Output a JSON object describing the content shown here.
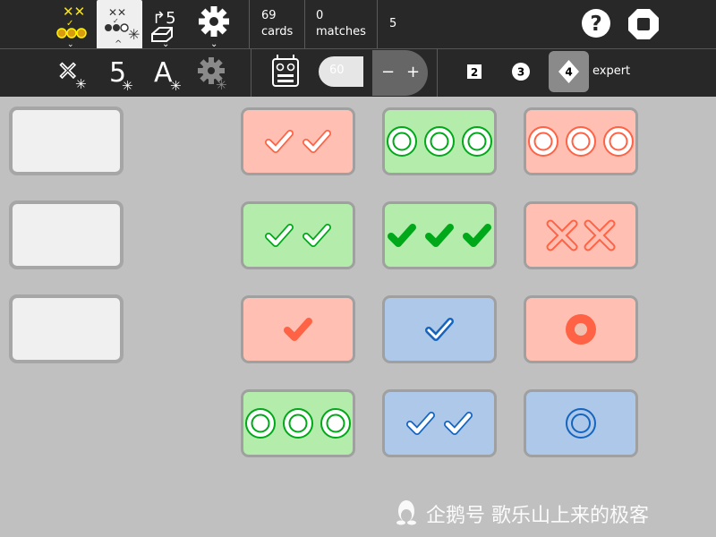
{
  "toolbar": {
    "stats": {
      "cards_count": "69",
      "cards_label": "cards",
      "matches_count": "0",
      "matches_label": "matches",
      "deck_remaining": "5"
    },
    "speed_value": "60",
    "stepper_minus": "−",
    "stepper_plus": "+",
    "levels": [
      "2",
      "3",
      "4"
    ],
    "active_level": "4",
    "level_name": "expert"
  },
  "watermark": "企鹅号 歌乐山上来的极客",
  "colors": {
    "red_card": "#ffc0b3",
    "red_shape": "#ff6244",
    "green_card": "#b3ecab",
    "green_shape": "#00a81a",
    "blue_card": "#adc8e8",
    "blue_shape": "#1565c0",
    "toolbar": "#282828"
  },
  "cards": [
    {
      "color": "red",
      "shape": "check",
      "fill": "outline",
      "count": 2
    },
    {
      "color": "green",
      "shape": "circle",
      "fill": "striped",
      "count": 3
    },
    {
      "color": "red",
      "shape": "circle",
      "fill": "striped",
      "count": 3
    },
    {
      "color": "green",
      "shape": "check",
      "fill": "outline",
      "count": 2
    },
    {
      "color": "green",
      "shape": "check",
      "fill": "solid",
      "count": 3
    },
    {
      "color": "red",
      "shape": "cross",
      "fill": "outline",
      "count": 2
    },
    {
      "color": "red",
      "shape": "check",
      "fill": "solid",
      "count": 1
    },
    {
      "color": "blue",
      "shape": "check",
      "fill": "striped",
      "count": 1
    },
    {
      "color": "red",
      "shape": "circle",
      "fill": "solid",
      "count": 1
    },
    {
      "color": "green",
      "shape": "circle",
      "fill": "striped",
      "count": 3
    },
    {
      "color": "blue",
      "shape": "check",
      "fill": "outline",
      "count": 2
    },
    {
      "color": "blue",
      "shape": "circle",
      "fill": "outline",
      "count": 1
    }
  ]
}
